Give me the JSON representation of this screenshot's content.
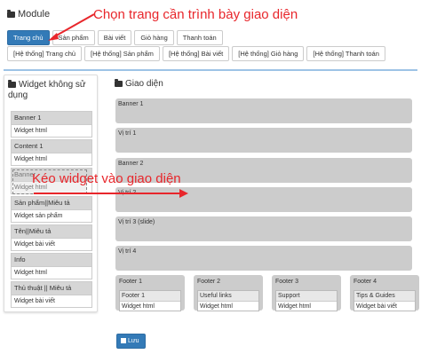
{
  "module": {
    "title": "Module"
  },
  "tabs": [
    "Trang chủ",
    "Sản phẩm",
    "Bài viết",
    "Giỏ hàng",
    "Thanh toán"
  ],
  "subtabs": [
    "[Hệ thống] Trang chủ",
    "[Hệ thống] Sản phẩm",
    "[Hệ thống] Bài viết",
    "[Hệ thống] Giỏ hàng",
    "[Hệ thống] Thanh toán"
  ],
  "unused": {
    "title": "Widget không sử dụng",
    "widgets": [
      {
        "name": "Banner 1",
        "type": "Widget html"
      },
      {
        "name": "Content 1",
        "type": "Widget html"
      },
      {
        "name": "Banner",
        "type": "Widget html"
      },
      {
        "name": "Sản phẩm||Miêu tả",
        "type": "Widget sản phẩm"
      },
      {
        "name": "Tên||Miêu tả",
        "type": "Widget bài viết"
      },
      {
        "name": "Info",
        "type": "Widget html"
      },
      {
        "name": "Thủ thuật || Miêu tả",
        "type": "Widget bài viết"
      }
    ]
  },
  "layout": {
    "title": "Giao diện",
    "positions": [
      "Banner 1",
      "Vị trí 1",
      "Banner 2",
      "Vị trí 2",
      "Vị trí 3 (slide)",
      "Vị trí 4"
    ],
    "footers": [
      {
        "label": "Footer 1",
        "name": "Footer 1",
        "type": "Widget html"
      },
      {
        "label": "Footer 2",
        "name": "Useful links",
        "type": "Widget html"
      },
      {
        "label": "Footer 3",
        "name": "Support",
        "type": "Widget html"
      },
      {
        "label": "Footer 4",
        "name": "Tips & Guides",
        "type": "Widget bài viết"
      }
    ]
  },
  "save_label": "Lưu",
  "annotations": {
    "top": "Chọn trang cần trình bày giao diện",
    "middle": "Kéo widget vào giao diện",
    "color": "#e8262b"
  }
}
